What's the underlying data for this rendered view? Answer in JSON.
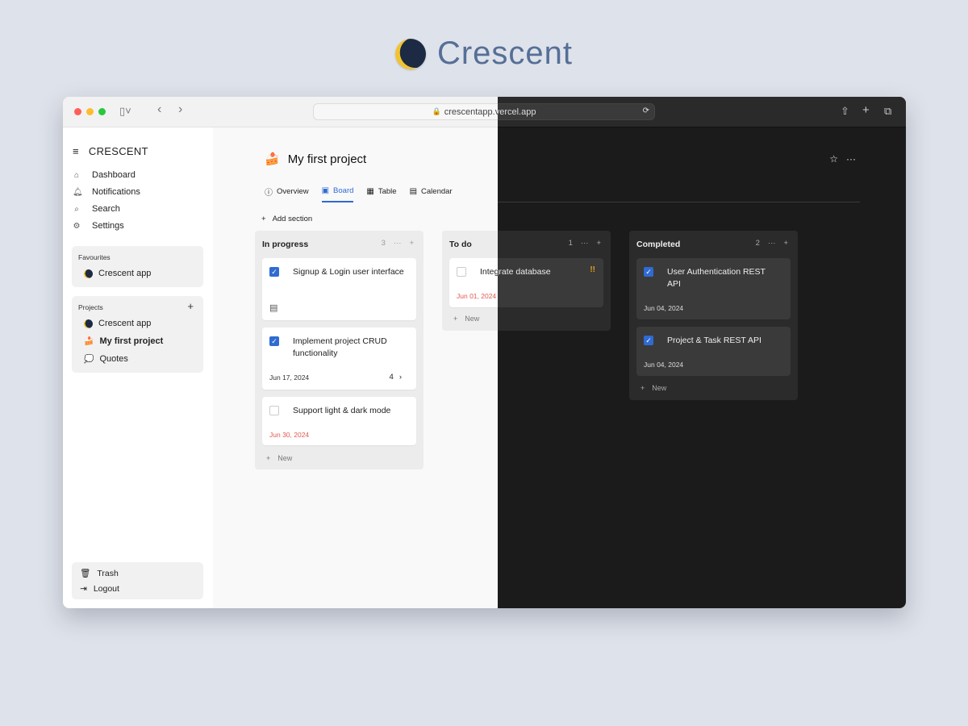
{
  "brand": {
    "name": "Crescent"
  },
  "browser": {
    "url": "crescentapp.vercel.app"
  },
  "sidebar": {
    "title": "CRESCENT",
    "nav": [
      {
        "label": "Dashboard",
        "icon": "home-icon"
      },
      {
        "label": "Notifications",
        "icon": "bell-icon"
      },
      {
        "label": "Search",
        "icon": "search-icon"
      },
      {
        "label": "Settings",
        "icon": "gear-icon"
      }
    ],
    "favourites": {
      "title": "Favourites",
      "items": [
        "Crescent app"
      ]
    },
    "projects": {
      "title": "Projects",
      "items": [
        "Crescent app",
        "My first project",
        "Quotes"
      ]
    },
    "bottom": {
      "trash": "Trash",
      "logout": "Logout"
    }
  },
  "project": {
    "title": "My first project",
    "tabs": [
      "Overview",
      "Board",
      "Table",
      "Calendar"
    ],
    "active_tab": "Board",
    "add_section": "Add section"
  },
  "board": {
    "new_label": "New",
    "columns": [
      {
        "title": "In progress",
        "count": "3",
        "cards": [
          {
            "text": "Signup & Login user interface",
            "checked": true
          },
          {
            "text": "Implement project CRUD functionality",
            "checked": true,
            "date": "Jun 17, 2024",
            "subtasks": "4"
          },
          {
            "text": "Support light & dark mode",
            "checked": false,
            "date": "Jun 30, 2024"
          }
        ]
      },
      {
        "title": "To do",
        "count": "1",
        "cards": [
          {
            "text": "Integrate database",
            "checked": false,
            "date": "Jun 01, 2024",
            "priority": "!!"
          }
        ]
      },
      {
        "title": "Completed",
        "count": "2",
        "cards": [
          {
            "text": "User Authentication REST API",
            "checked": true,
            "date": "Jun 04, 2024"
          },
          {
            "text": "Project & Task REST API",
            "checked": true,
            "date": "Jun 04, 2024"
          }
        ]
      }
    ]
  },
  "colors": {
    "accent": "#2f6bd1",
    "overdue": "#e05a4f",
    "brand": "#566f97",
    "dark_bg": "#1b1b1b"
  }
}
